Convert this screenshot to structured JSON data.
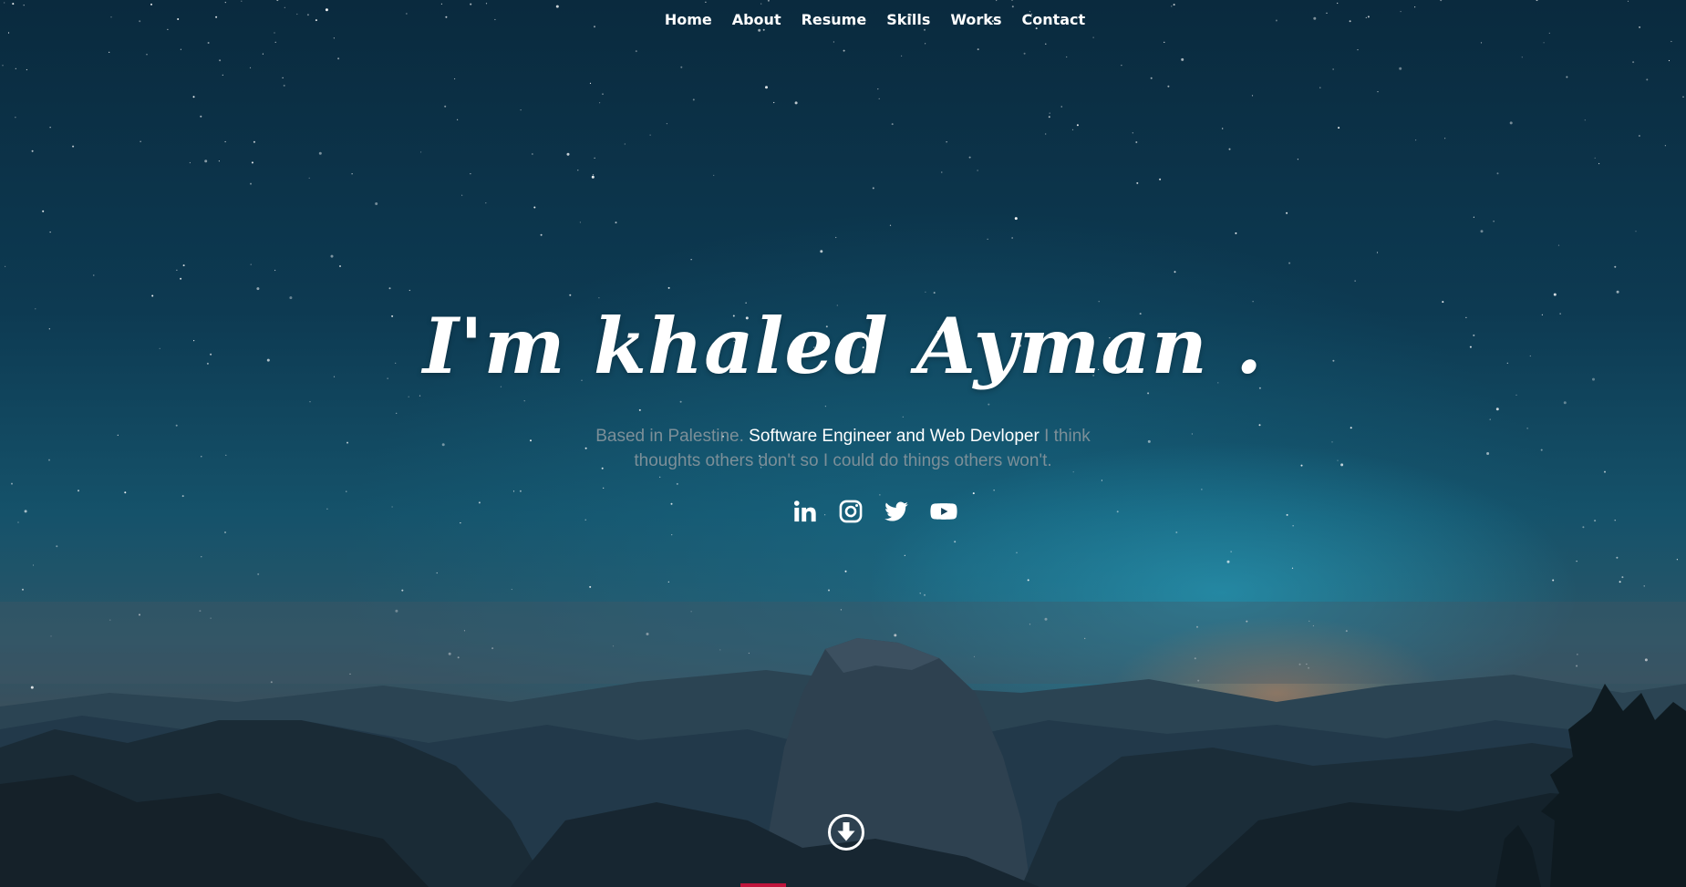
{
  "nav": {
    "items": [
      {
        "label": "Home"
      },
      {
        "label": "About"
      },
      {
        "label": "Resume"
      },
      {
        "label": "Skills"
      },
      {
        "label": "Works"
      },
      {
        "label": "Contact"
      }
    ]
  },
  "hero": {
    "title": "I'm khaled Ayman .",
    "subtitle_before": "Based in Palestine.",
    "subtitle_highlight": "Software Engineer and Web Devloper",
    "subtitle_after_line1": "I think",
    "subtitle_line2": "thoughts others don't so I could do things others won't."
  },
  "social": [
    {
      "icon": "linkedin-icon"
    },
    {
      "icon": "instagram-icon"
    },
    {
      "icon": "twitter-icon"
    },
    {
      "icon": "youtube-icon"
    }
  ],
  "scroll": {
    "icon": "arrow-down-circle-icon"
  },
  "colors": {
    "text": "#ffffff",
    "muted_text": "#7c8f98",
    "accent": "#c0143c",
    "sky_dark": "#0a2a3e",
    "sky_glow": "#28aac8"
  }
}
